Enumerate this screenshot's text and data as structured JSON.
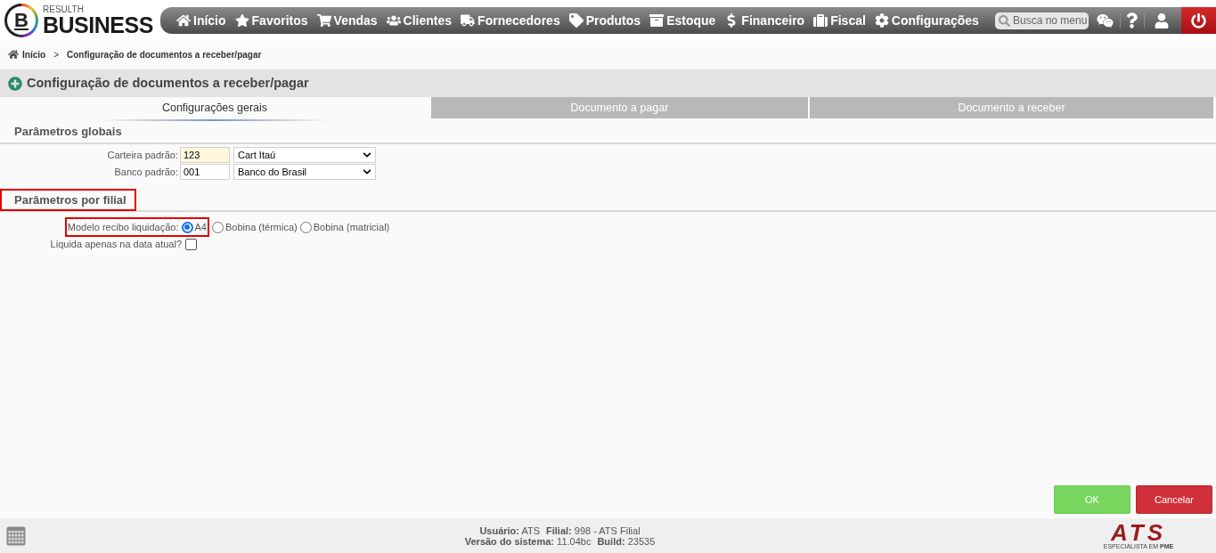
{
  "header": {
    "logo": {
      "mark": "B",
      "tagline": "RESULTH",
      "name": "BUSINESS"
    },
    "nav": [
      "Início",
      "Favoritos",
      "Vendas",
      "Clientes",
      "Fornecedores",
      "Produtos",
      "Estoque",
      "Financeiro",
      "Fiscal",
      "Configurações"
    ],
    "search": {
      "placeholder": "Busca no menu"
    }
  },
  "breadcrumb": {
    "items": [
      "Início",
      "Configuração de documentos a receber/pagar"
    ],
    "separator": ">"
  },
  "page_title": "Configuração de documentos a receber/pagar",
  "tabs": [
    {
      "label": "Configurações gerais",
      "selected": true
    },
    {
      "label": "Documento a pagar",
      "selected": false
    },
    {
      "label": "Documento a receber",
      "selected": false
    }
  ],
  "sections": [
    {
      "title": "Parâmetros globais",
      "highlighted": false,
      "fields": [
        {
          "kind": "code_select",
          "label": "Carteira padrão:",
          "code": "123",
          "focused": true,
          "value": "Cart Itaú"
        },
        {
          "kind": "code_select",
          "label": "Banco padrão:",
          "code": "001",
          "focused": false,
          "value": "Banco do Brasil"
        }
      ]
    },
    {
      "title": "Parâmetros por filial",
      "highlighted": true,
      "fields": [
        {
          "kind": "radio",
          "label": "Modelo recibo liquidação:",
          "highlighted": true,
          "options": [
            {
              "label": "A4",
              "selected": true
            },
            {
              "label": "Bobina (térmica)",
              "selected": false
            },
            {
              "label": "Bobina (matricial)",
              "selected": false
            }
          ]
        },
        {
          "kind": "checkbox",
          "label": "Liquida apenas na data atual?",
          "checked": false
        }
      ]
    }
  ],
  "buttons": [
    {
      "label": "OK",
      "kind": "confirm"
    },
    {
      "label": "Cancelar",
      "kind": "cancel"
    }
  ],
  "status_bar": {
    "lines": [
      [
        {
          "label": "Usuário:",
          "value": "ATS"
        },
        {
          "label": "Filial:",
          "value": "998 - ATS Filial"
        }
      ],
      [
        {
          "label": "Versão do sistema:",
          "value": "11.04bc"
        },
        {
          "label": "Build:",
          "value": "23535"
        }
      ]
    ],
    "logo": {
      "name": "ATS",
      "tagline": "ESPECIALISTA EM **PME**"
    }
  }
}
